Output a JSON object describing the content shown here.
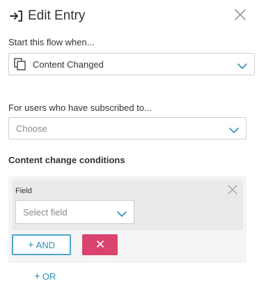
{
  "header": {
    "title": "Edit Entry",
    "icon": "enter-icon",
    "close_icon": "close-icon"
  },
  "trigger": {
    "label": "Start this flow when...",
    "selected_value": "Content Changed",
    "icon": "content-copy-icon"
  },
  "subscription": {
    "label": "For users who have subscribed to...",
    "placeholder": "Choose"
  },
  "conditions": {
    "title": "Content change conditions",
    "field_label": "Field",
    "field_placeholder": "Select field",
    "and_label": "AND",
    "remove_icon": "times-icon",
    "or_label": "OR"
  },
  "colors": {
    "accent": "#4aa6c9",
    "danger": "#d9436e",
    "border": "#cfcfcf",
    "panel_bg": "#f4f4f4"
  }
}
